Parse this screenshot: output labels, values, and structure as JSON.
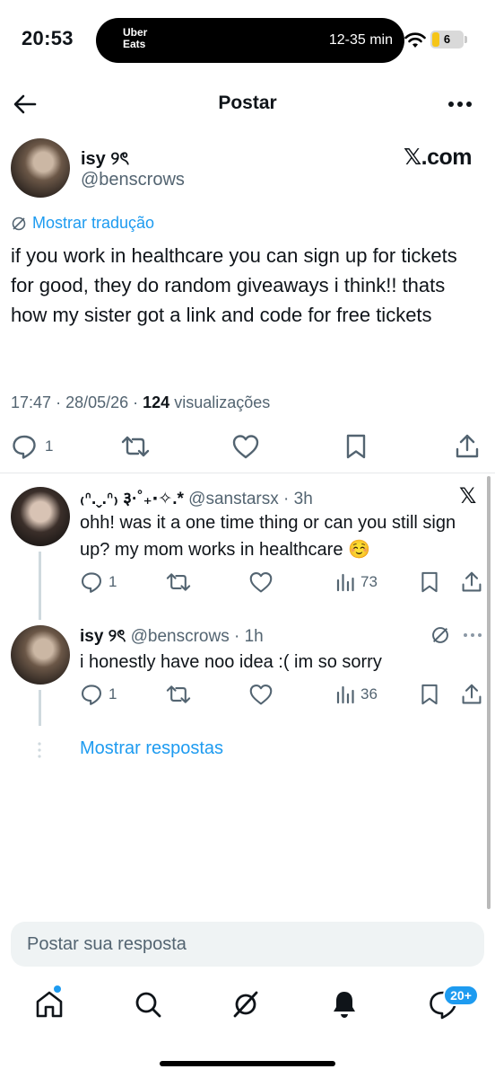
{
  "status_bar": {
    "time": "20:53",
    "live_activity": {
      "app_line1": "Uber",
      "app_line2": "Eats",
      "eta": "12-35 min"
    },
    "battery": "6"
  },
  "header": {
    "title": "Postar",
    "back_icon": "arrow-left-icon",
    "more_icon": "ellipsis-icon"
  },
  "post": {
    "author_name": "isy ୨ৎ",
    "author_handle": "@benscrows",
    "badge_text": "𝕏.com",
    "translate_label": "Mostrar tradução",
    "text": "if you work in healthcare you can sign up for tickets for good, they do random giveaways i think!! thats how my sister got a link and code for free tickets",
    "time": "17:47",
    "date": "28/05/26",
    "views_count": "124",
    "views_label": "visualizações",
    "reply_count": "1"
  },
  "replies": [
    {
      "name": "₍ᐢ.ˬ.ᐢ₎ ३·˚₊‧✧.*",
      "handle": "@sanstarsx",
      "age": "3h",
      "text": "ohh! was it a one time thing or can you still sign up? my mom works in healthcare ☺️",
      "reply_count": "1",
      "views": "73"
    },
    {
      "name": "isy ୨ৎ",
      "handle": "@benscrows",
      "age": "1h",
      "text": "i honestly have noo idea :( im so sorry",
      "reply_count": "1",
      "views": "36"
    }
  ],
  "show_replies_label": "Mostrar respostas",
  "composer": {
    "placeholder": "Postar sua resposta"
  },
  "tabbar": {
    "messages_badge": "20+"
  },
  "colors": {
    "accent": "#1d9bf0",
    "text": "#0f1419",
    "muted": "#536471"
  }
}
